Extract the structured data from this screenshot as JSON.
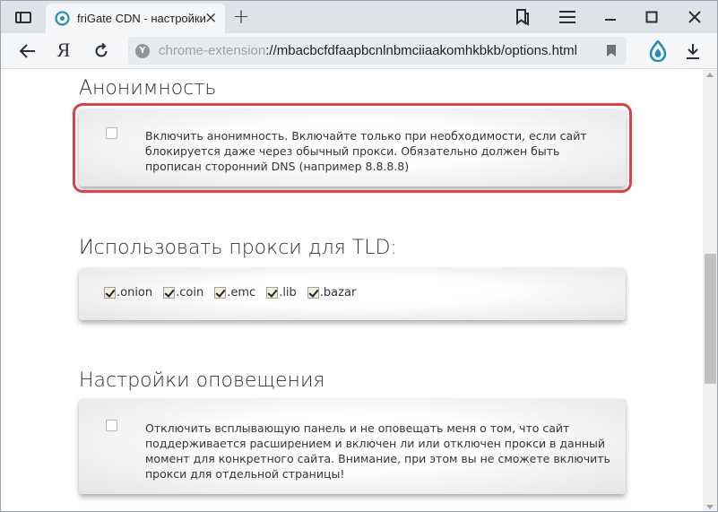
{
  "browser": {
    "tab": {
      "title": "friGate CDN - настройки"
    },
    "address": {
      "scheme": "chrome-extension",
      "rest": "://mbacbcfdfaapbcnlnbmciiaakomhkbkb/options.html"
    },
    "yandex_glyph": "Я",
    "site_icon_glyph": "Y",
    "icons": {
      "sidebar": "sidebar-icon",
      "close_tab": "close-icon",
      "new_tab": "plus-icon",
      "bookmarks": "bookmarks-icon",
      "menu": "hamburger-menu-icon",
      "minimize": "minimize-icon",
      "maximize": "maximize-icon",
      "close_window": "close-icon",
      "back": "arrow-left-icon",
      "reload": "reload-icon",
      "bookmark": "bookmark-flag-icon",
      "protect": "protect-shield-icon",
      "download": "download-icon"
    }
  },
  "page": {
    "anonymity": {
      "title": "Анонимность",
      "checked": false,
      "lines": [
        "Включить анонимность. Включайте только при необходимости, если сайт",
        "блокируется даже через обычный прокси. Обязательно должен быть",
        "прописан сторонний DNS (например 8.8.8.8)"
      ]
    },
    "tld": {
      "title": "Использовать прокси для TLD:",
      "items": [
        {
          "label": ".onion",
          "checked": true
        },
        {
          "label": ".coin",
          "checked": true
        },
        {
          "label": ".emc",
          "checked": true
        },
        {
          "label": ".lib",
          "checked": true
        },
        {
          "label": ".bazar",
          "checked": true
        }
      ]
    },
    "notifications": {
      "title": "Настройки оповещения",
      "checked": false,
      "lines": [
        "Отключить всплывающую панель и не оповещать меня о том, что сайт",
        "поддерживается расширением и включен ли или отключен прокси в данный",
        "момент для конкретного сайта. Внимание, при этом вы не сможете включить",
        "прокси для отдельной страницы!"
      ]
    }
  },
  "colors": {
    "highlight": "#d8434a",
    "checkbox_checked_bg": "#f1eedd"
  }
}
